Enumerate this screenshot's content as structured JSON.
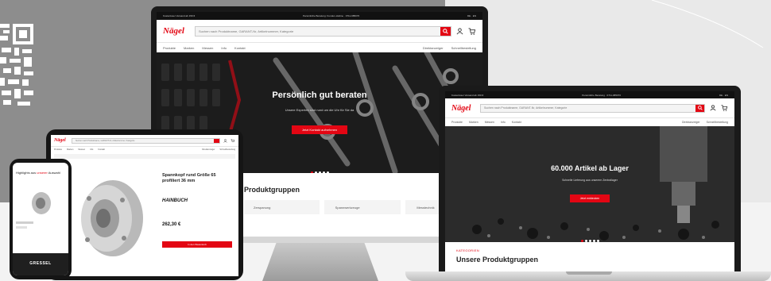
{
  "colors": {
    "brand_red": "#e30613",
    "dark": "#1a1a1a",
    "bg_gray": "#8d8d8d"
  },
  "brand": {
    "logo": "Nägel"
  },
  "monitor": {
    "topbar_left": "Kostenloser Versand ab 150 €",
    "topbar_center": "Persönliche Beratung: Kunden-Hotline · 0711-985070",
    "topbar_right": "DE · EN",
    "search_placeholder": "Suchen nach Produktname, GARANT-Nr, Artikelnummer, Kategorie",
    "nav": [
      "Produkte",
      "Marken",
      "Messen",
      "Info",
      "Kontakt"
    ],
    "nav_right": [
      "Direktanzeiger",
      "Schnellbestellung"
    ],
    "hero_title": "Persönlich gut beraten",
    "hero_sub": "Unsere Experten sind rund um die Uhr für Sie da",
    "hero_cta": "Jetzt Kontakt aufnehmen",
    "section_title": "Produktgruppen",
    "categories": [
      "Zerspanung",
      "Spannwerkzeuge",
      "Messtechnik"
    ]
  },
  "laptop": {
    "topbar_left": "Kostenloser Versand ab 150 €",
    "topbar_center": "Persönliche Beratung · 0711-985070",
    "topbar_right": "DE · EN",
    "search_placeholder": "Suchen nach Produktname, GARANT-Nr, Artikelnummer, Kategorie",
    "nav": [
      "Produkte",
      "Marken",
      "Messen",
      "Info",
      "Kontakt"
    ],
    "nav_right": [
      "Direktanzeiger",
      "Schnellbestellung"
    ],
    "hero_title": "60.000 Artikel ab Lager",
    "hero_sub": "Schnelle Lieferung aus unserem Zentrallager",
    "hero_cta": "Jetzt entdecken",
    "section_label": "KATEGORIEN",
    "section_title": "Unsere Produktgruppen"
  },
  "tablet": {
    "search_placeholder": "Suchen nach Produktname, GARANT-Nr, Artikelnummer, Kategorie",
    "nav": [
      "Produkte",
      "Marken",
      "Messen",
      "Info",
      "Kontakt"
    ],
    "nav_right": [
      "Direktanzeiger",
      "Schnellbestellung"
    ],
    "product_title": "Spannkopf rund Größe 65 profiliert 36 mm",
    "product_brand": "HAINBUCH",
    "price": "262,30 €",
    "add_to_cart": "In den Warenkorb"
  },
  "phone": {
    "headline_prefix": "Highlights aus ",
    "headline_accent": "unserer",
    "headline_rest": " Auswahl",
    "promo_brand": "GRESSEL"
  }
}
